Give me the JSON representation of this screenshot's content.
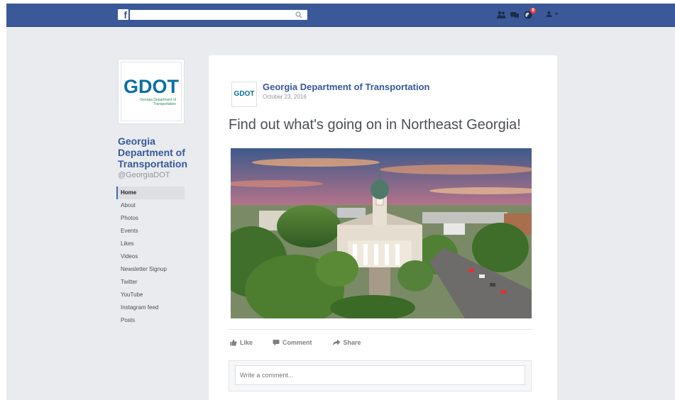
{
  "topbar": {
    "brand_letter": "f",
    "search": {
      "value": "",
      "placeholder": ""
    },
    "notification_count": "9"
  },
  "page": {
    "logo_text": "GDOT",
    "logo_sub": "Georgia Department of Transportation",
    "name": "Georgia Department of Transportation",
    "handle": "@GeorgiaDOT",
    "nav": [
      {
        "label": "Home",
        "active": true
      },
      {
        "label": "About"
      },
      {
        "label": "Photos"
      },
      {
        "label": "Events"
      },
      {
        "label": "Likes"
      },
      {
        "label": "Videos"
      },
      {
        "label": "Newsletter Signup"
      },
      {
        "label": "Twitter"
      },
      {
        "label": "YouTube"
      },
      {
        "label": "Instagram feed"
      },
      {
        "label": "Posts"
      }
    ]
  },
  "post": {
    "author": "Georgia Department of Transportation",
    "date": "October 23, 2016",
    "text": "Find out what's going on in Northeast Georgia!",
    "image_alt": "Aerial view of a domed courthouse in a tree-lined town square at sunset",
    "actions": {
      "like": "Like",
      "comment": "Comment",
      "share": "Share"
    },
    "comment_placeholder": "Write a comment..."
  },
  "colors": {
    "facebook_blue": "#3b5998",
    "link_blue": "#365899",
    "background": "#e9ebee",
    "gdot_blue": "#0a6fa3",
    "gdot_green": "#2a8c5a"
  },
  "icons": [
    "facebook-logo-icon",
    "search-icon",
    "friend-requests-icon",
    "messages-icon",
    "notifications-globe-icon",
    "account-icon",
    "chevron-down-icon",
    "like-thumb-icon",
    "comment-bubble-icon",
    "share-arrow-icon"
  ]
}
